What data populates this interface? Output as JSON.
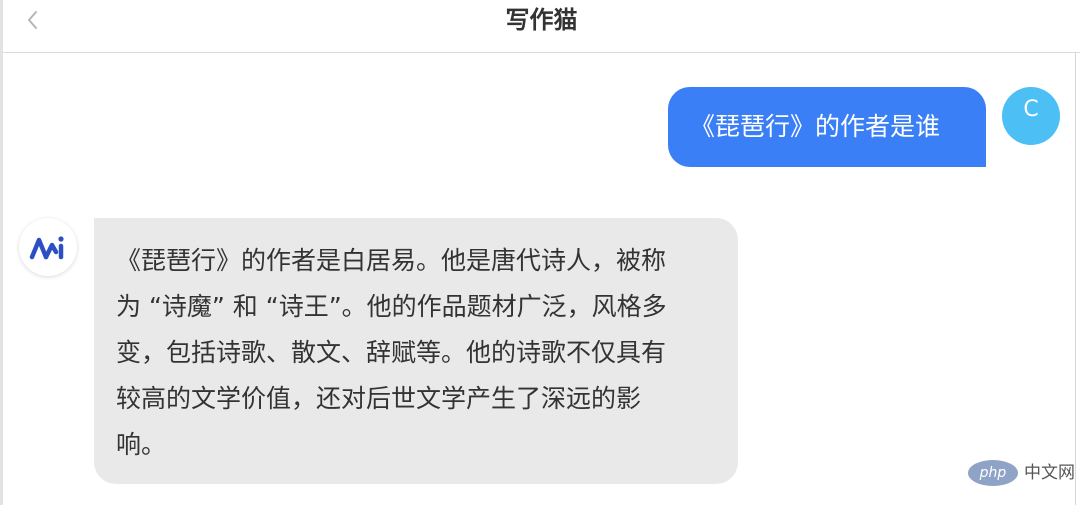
{
  "header": {
    "title": "写作猫",
    "back_icon": "chevron-left-icon"
  },
  "conversation": {
    "user_message": {
      "text": "《琵琶行》的作者是谁",
      "avatar_letter": "C",
      "avatar_color": "#4cbff5",
      "bubble_color": "#3a7ff6"
    },
    "bot_message": {
      "avatar_icon": "mi-logo-icon",
      "lines": [
        "《琵琶行》的作者是白居易。他是唐代诗人，被称",
        "为 “诗魔” 和 “诗王”。他的作品题材广泛，风格多",
        "变，包括诗歌、散文、辞赋等。他的诗歌不仅具有",
        "较高的文学价值，还对后世文学产生了深远的影",
        "响。"
      ],
      "bubble_color": "#e9e9e9"
    }
  },
  "watermark": {
    "logo_text": "php",
    "label": "中文网"
  }
}
